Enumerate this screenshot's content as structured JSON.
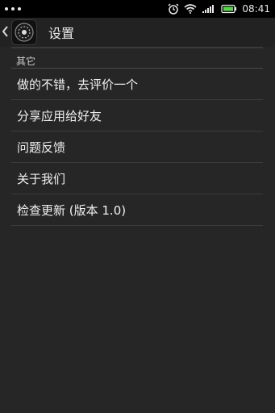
{
  "status_bar": {
    "time": "08:41",
    "icons": [
      "dots-icon",
      "alarm-icon",
      "wifi-icon",
      "signal-icon",
      "battery-icon"
    ]
  },
  "action_bar": {
    "title": "设置",
    "back_icon": "chevron-left-icon",
    "app_icon": "app-icon"
  },
  "section": {
    "header": "其它",
    "items": [
      {
        "label": "做的不错，去评价一个"
      },
      {
        "label": "分享应用给好友"
      },
      {
        "label": "问题反馈"
      },
      {
        "label": "关于我们"
      },
      {
        "label": "检查更新 (版本 1.0)"
      }
    ]
  },
  "colors": {
    "background": "#262626",
    "status_bar": "#000000",
    "divider": "#3c3c3c",
    "text": "#f0f0f0"
  }
}
